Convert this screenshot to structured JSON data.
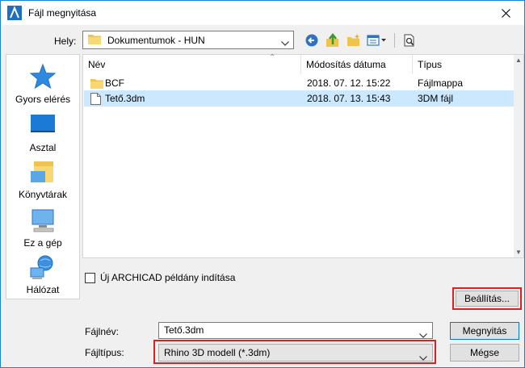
{
  "window": {
    "title": "Fájl megnyitása"
  },
  "lookin": {
    "label": "Hely:",
    "value": "Dokumentumok - HUN"
  },
  "toolbar": {
    "icons": [
      "back-icon",
      "up-folder-icon",
      "new-folder-icon",
      "view-menu-icon",
      "preview-icon"
    ]
  },
  "places": [
    {
      "label": "Gyors elérés",
      "icon": "star-icon"
    },
    {
      "label": "Asztal",
      "icon": "desktop-icon"
    },
    {
      "label": "Könyvtárak",
      "icon": "libraries-icon"
    },
    {
      "label": "Ez a gép",
      "icon": "computer-icon"
    },
    {
      "label": "Hálózat",
      "icon": "network-icon"
    }
  ],
  "filelist": {
    "columns": {
      "name": "Név",
      "modified": "Módosítás dátuma",
      "type": "Típus"
    },
    "rows": [
      {
        "name": "BCF",
        "modified": "2018. 07. 12. 15:22",
        "type": "Fájlmappa",
        "icon": "folder-icon"
      },
      {
        "name": "Tető.3dm",
        "modified": "2018. 07. 13. 15:43",
        "type": "3DM fájl",
        "icon": "file-icon"
      }
    ]
  },
  "options": {
    "new_instance_label": "Új ARCHICAD példány indítása"
  },
  "buttons": {
    "settings": "Beállítás...",
    "open": "Megnyitás",
    "cancel": "Mégse"
  },
  "filename": {
    "label": "Fájlnév:",
    "value": "Tető.3dm"
  },
  "filetype": {
    "label": "Fájltípus:",
    "value": "Rhino 3D modell (*.3dm)"
  },
  "colors": {
    "accent": "#0078d7",
    "selection": "#cce8ff",
    "highlight": "#e02020"
  }
}
